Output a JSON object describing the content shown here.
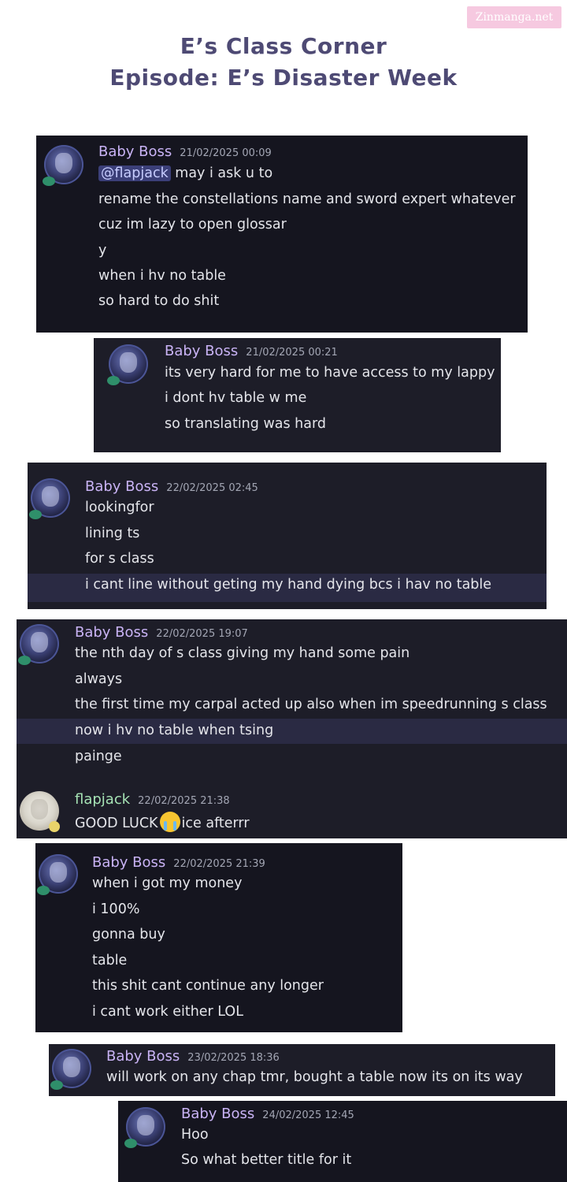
{
  "watermark": "Zinmanga.net",
  "title": {
    "line1": "E’s Class Corner",
    "line2": "Episode: E’s Disaster Week"
  },
  "cards": [
    {
      "messages": [
        {
          "author": "Baby Boss",
          "timestamp": "21/02/2025 00:09",
          "mention": "@flapjack",
          "lines": [
            "may i ask  u to",
            "rename the constellations name and sword expert whatever",
            "cuz im lazy to open glossar",
            "y",
            "when i hv no table",
            "so hard to do shit"
          ]
        }
      ]
    },
    {
      "messages": [
        {
          "author": "Baby Boss",
          "timestamp": "21/02/2025 00:21",
          "lines": [
            "its very hard for me to have access to my lappy",
            "i dont hv table w me",
            "so translating was hard"
          ]
        }
      ]
    },
    {
      "messages": [
        {
          "author": "Baby Boss",
          "timestamp": "22/02/2025 02:45",
          "lines": [
            "lookingfor",
            "lining ts",
            "for s class",
            "i cant line without geting my hand dying bcs i hav no table"
          ]
        }
      ]
    },
    {
      "messages": [
        {
          "author": "Baby Boss",
          "timestamp": "22/02/2025 19:07",
          "lines": [
            "the nth day of s class giving my hand some pain",
            "always",
            "the first time my carpal acted up also when im speedrunning s class",
            "now i hv no table when tsing",
            "painge"
          ]
        },
        {
          "author": "flapjack",
          "timestamp": "22/02/2025 21:38",
          "lines_before_emoji": "GOOD LUCK",
          "emoji": "loudly-crying-face",
          "lines_after_emoji": "ice afterrr"
        }
      ]
    },
    {
      "messages": [
        {
          "author": "Baby Boss",
          "timestamp": "22/02/2025 21:39",
          "lines": [
            "when i got my money",
            "i 100%",
            "gonna buy",
            "table",
            "this shit cant continue any longer",
            "i cant work either LOL"
          ]
        }
      ]
    },
    {
      "messages": [
        {
          "author": "Baby Boss",
          "timestamp": "23/02/2025 18:36",
          "lines": [
            "will work on any chap tmr, bought a table now its on its way"
          ]
        }
      ]
    },
    {
      "messages": [
        {
          "author": "Baby Boss",
          "timestamp": "24/02/2025 12:45",
          "lines": [
            "Hoo",
            "So what better title for it"
          ]
        }
      ]
    }
  ]
}
